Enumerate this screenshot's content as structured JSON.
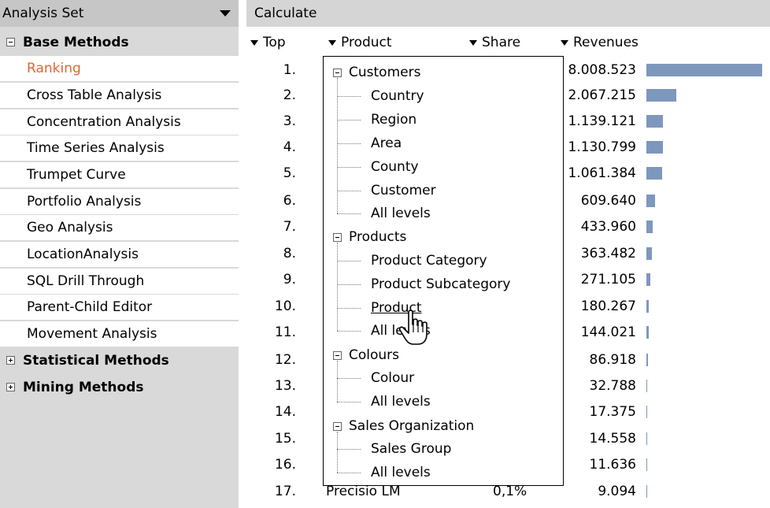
{
  "sidebar": {
    "header": "Analysis Set",
    "groups": [
      {
        "label": "Base Methods",
        "expanded": true
      },
      {
        "label": "Statistical Methods",
        "expanded": false
      },
      {
        "label": "Mining Methods",
        "expanded": false
      }
    ],
    "items": [
      "Ranking",
      "Cross Table Analysis",
      "Concentration Analysis",
      "Time Series Analysis",
      "Trumpet Curve",
      "Portfolio Analysis",
      "Geo Analysis",
      "LocationAnalysis",
      "SQL Drill Through",
      "Parent-Child Editor",
      "Movement Analysis"
    ],
    "active_item": "Ranking"
  },
  "main": {
    "title": "Calculate",
    "columns": {
      "top": "Top",
      "product": "Product",
      "share": "Share",
      "revenues": "Revenues"
    },
    "rows": [
      {
        "rank": "1.",
        "revenue": "8.008.523",
        "bar_fraction": 1.0
      },
      {
        "rank": "2.",
        "revenue": "2.067.215",
        "bar_fraction": 0.258
      },
      {
        "rank": "3.",
        "revenue": "1.139.121",
        "bar_fraction": 0.142
      },
      {
        "rank": "4.",
        "revenue": "1.130.799",
        "bar_fraction": 0.141
      },
      {
        "rank": "5.",
        "revenue": "1.061.384",
        "bar_fraction": 0.133
      },
      {
        "rank": "6.",
        "revenue": "609.640",
        "bar_fraction": 0.076
      },
      {
        "rank": "7.",
        "revenue": "433.960",
        "bar_fraction": 0.054
      },
      {
        "rank": "8.",
        "revenue": "363.482",
        "bar_fraction": 0.045
      },
      {
        "rank": "9.",
        "revenue": "271.105",
        "bar_fraction": 0.034
      },
      {
        "rank": "10.",
        "revenue": "180.267",
        "bar_fraction": 0.023
      },
      {
        "rank": "11.",
        "revenue": "144.021",
        "bar_fraction": 0.018
      },
      {
        "rank": "12.",
        "revenue": "86.918",
        "bar_fraction": 0.011
      },
      {
        "rank": "13.",
        "revenue": "32.788",
        "bar_fraction": 0.004
      },
      {
        "rank": "14.",
        "revenue": "17.375",
        "bar_fraction": 0.002
      },
      {
        "rank": "15.",
        "revenue": "14.558",
        "bar_fraction": 0.002
      },
      {
        "rank": "16.",
        "revenue": "11.636",
        "bar_fraction": 0.001
      },
      {
        "rank": "17.",
        "product": "Precisio LM",
        "share": "0,1%",
        "revenue": "9.094",
        "bar_fraction": 0.001
      }
    ]
  },
  "popup": {
    "groups": [
      {
        "label": "Customers",
        "children": [
          "Country",
          "Region",
          "Area",
          "County",
          "Customer",
          "All levels"
        ]
      },
      {
        "label": "Products",
        "children": [
          "Product Category",
          "Product Subcategory",
          "Product",
          "All levels"
        ]
      },
      {
        "label": "Colours",
        "children": [
          "Colour",
          "All levels"
        ]
      },
      {
        "label": "Sales Organization",
        "children": [
          "Sales Group",
          "All levels"
        ]
      }
    ],
    "hovered": "Product"
  },
  "colors": {
    "accent": "#e0662e",
    "bar": "#7e97bd",
    "sidebar_bg": "#d9d9d9"
  },
  "icons": {
    "dropdown": "dropdown-arrow-icon",
    "collapse": "minus-box-icon",
    "expand": "plus-box-icon",
    "cursor": "hand-pointer-icon"
  }
}
